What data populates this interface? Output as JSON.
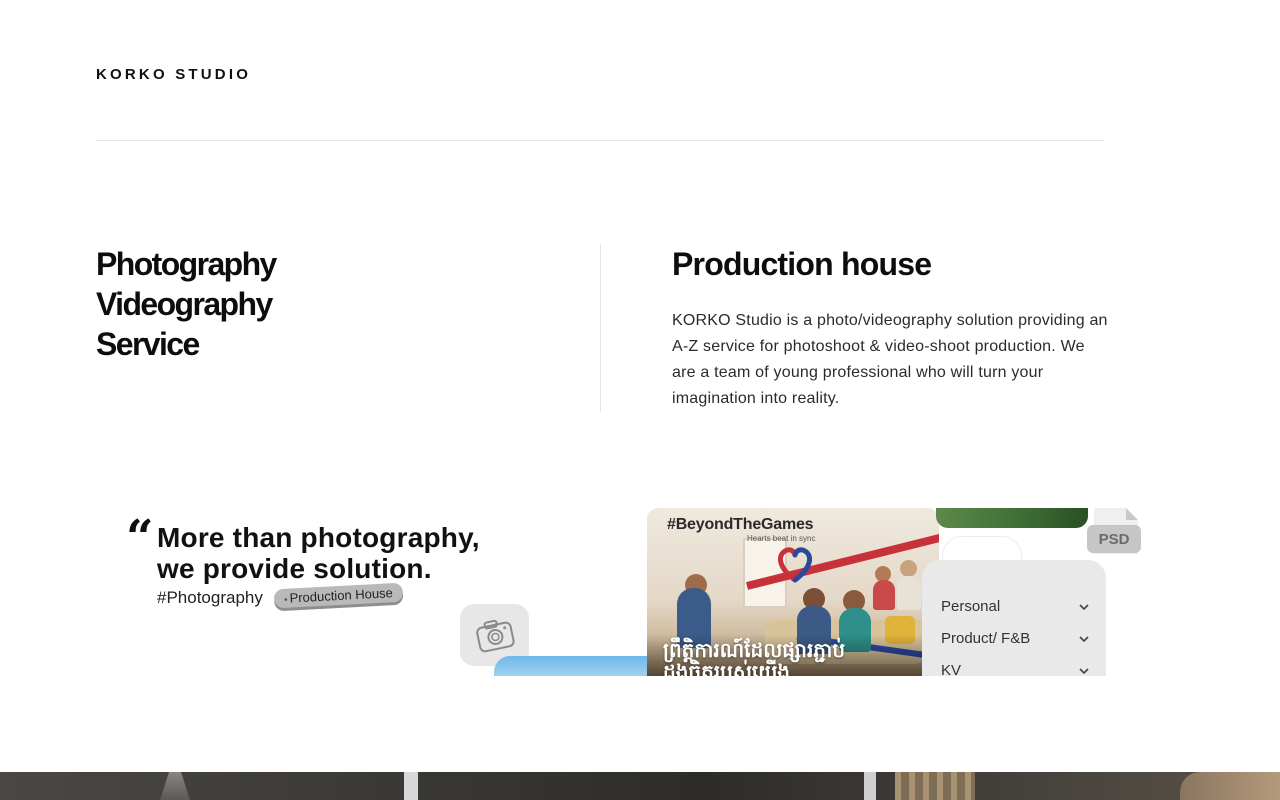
{
  "header": {
    "brand": "KORKO STUDIO"
  },
  "services": {
    "items": [
      "Photography",
      "Videography",
      "Service"
    ]
  },
  "about": {
    "heading": "Production house",
    "description": "KORKO Studio is a photo/videography solution providing an A-Z service for photoshoot & video-shoot production. We are a team of young professional who will turn your imagination into reality."
  },
  "banner": {
    "quote_line_1": "More than photography,",
    "quote_line_2": "we provide solution.",
    "hashtag": "#Photography",
    "pill": "Production House",
    "photo_title": "#BeyondTheGames",
    "photo_subtitle": "Hearts beat in sync",
    "photo_khmer_line_1": "ព្រឹត្តិការណ៍ដែលផ្សារភ្ជាប់",
    "photo_khmer_line_2": "ដួងចិត្តរបស់យើង",
    "psd_label": "PSD",
    "menu": [
      "Personal",
      "Product/ F&B",
      "KV"
    ],
    "icons": [
      "camera-icon",
      "chevron-down-icon",
      "psd-file-icon",
      "heart-ribbon-icon"
    ]
  },
  "colors": {
    "text": "#111111",
    "divider": "#e6e6e6",
    "menu_panel": "#e9e9e9",
    "pill_bg": "#b9b9b9"
  }
}
